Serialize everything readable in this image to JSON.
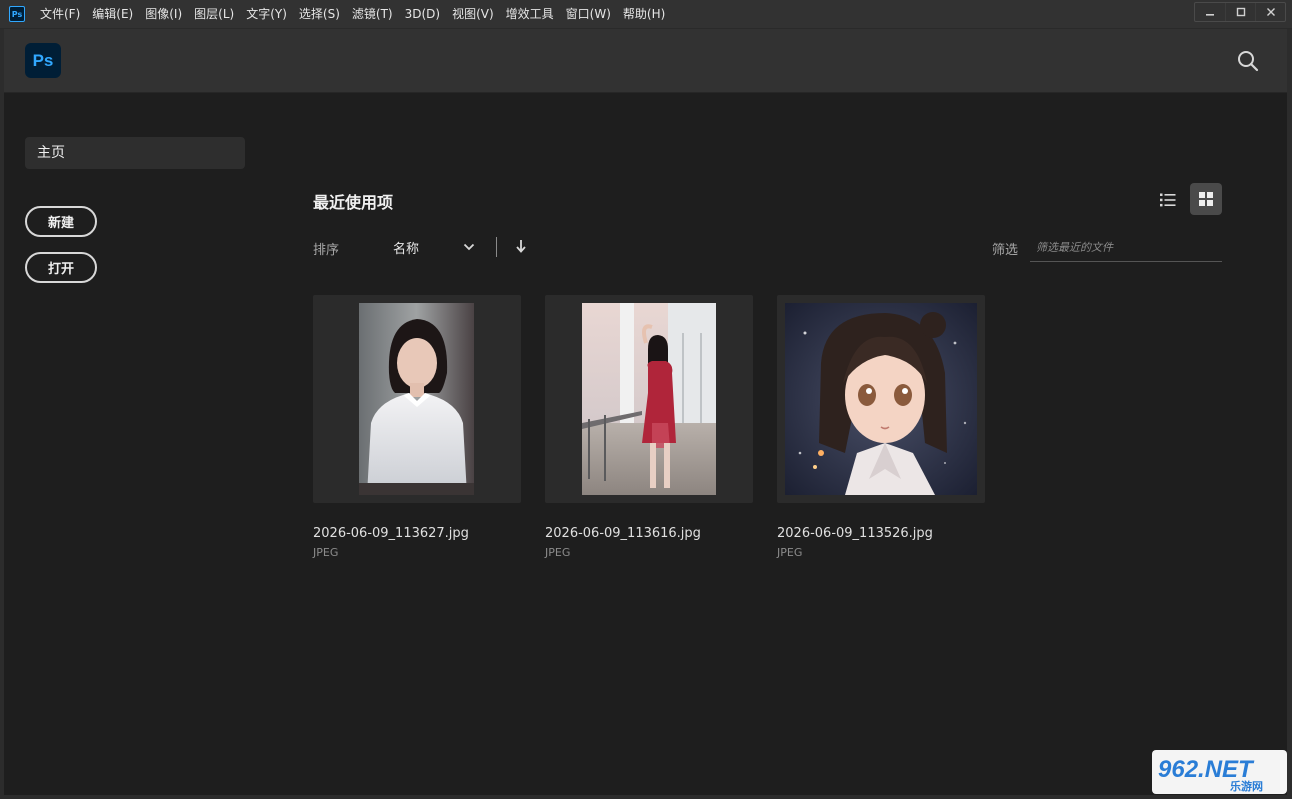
{
  "window": {
    "app_icon": "Ps",
    "menu": [
      "文件(F)",
      "编辑(E)",
      "图像(I)",
      "图层(L)",
      "文字(Y)",
      "选择(S)",
      "滤镜(T)",
      "3D(D)",
      "视图(V)",
      "增效工具",
      "窗口(W)",
      "帮助(H)"
    ],
    "controls": {
      "minimize": "▁",
      "maximize": "☐",
      "close": "✕"
    }
  },
  "header": {
    "logo_text": "Ps",
    "search_icon": "search-icon"
  },
  "sidebar": {
    "home_label": "主页",
    "new_label": "新建",
    "open_label": "打开"
  },
  "recent": {
    "title": "最近使用项",
    "sort_label": "排序",
    "sort_value": "名称",
    "filter_label": "筛选",
    "filter_placeholder": "筛选最近的文件",
    "files": [
      {
        "name": "2026-06-09_113627.jpg",
        "type": "JPEG"
      },
      {
        "name": "2026-06-09_113616.jpg",
        "type": "JPEG"
      },
      {
        "name": "2026-06-09_113526.jpg",
        "type": "JPEG"
      }
    ]
  },
  "watermark": {
    "text": "962.NET",
    "subtext": "乐游网"
  },
  "colors": {
    "accent": "#31a8ff",
    "logo_bg": "#001e36",
    "panel": "#323232",
    "bg": "#1e1e1e"
  }
}
